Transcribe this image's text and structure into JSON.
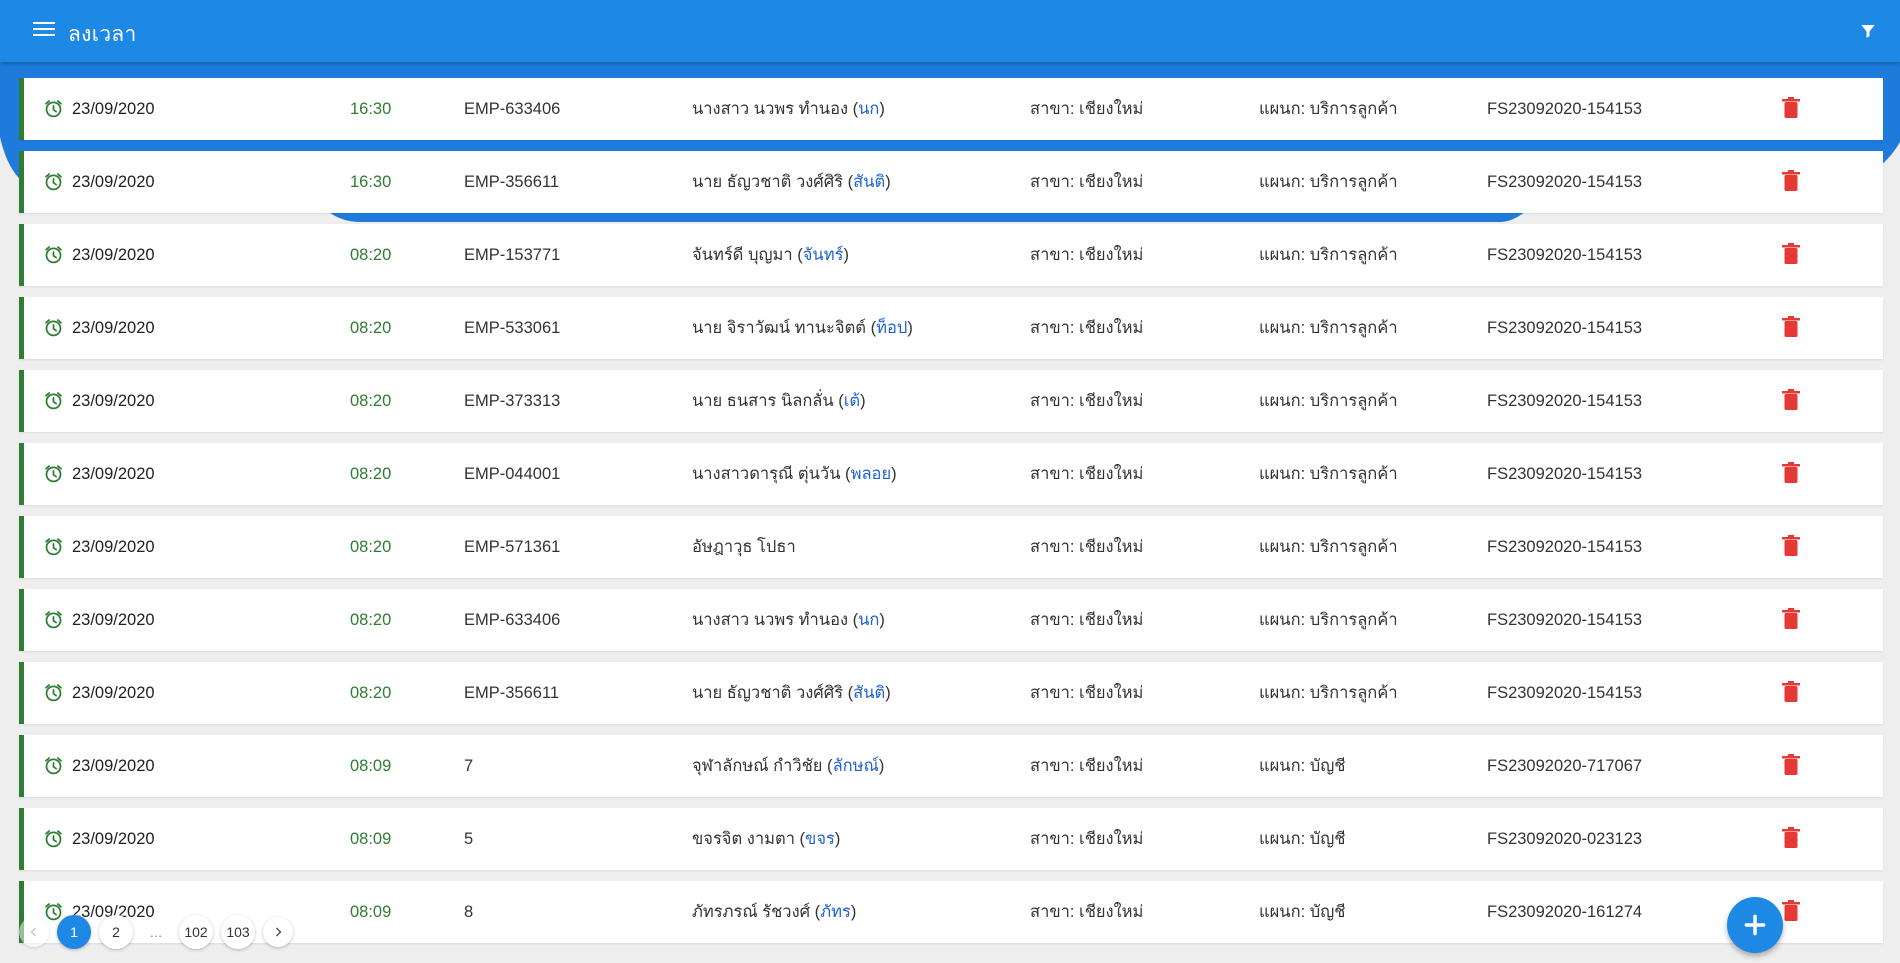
{
  "appbar": {
    "title": "ลงเวลา",
    "menu_icon": "menu-icon",
    "filter_icon": "filter-icon",
    "color": "#1e88e5"
  },
  "rows": [
    {
      "date": "23/09/2020",
      "time": "16:30",
      "emp": "EMP-633406",
      "name": "นางสาว นวพร ทำนอง (",
      "nick": "นก",
      "close": ")",
      "branch": "สาขา: เชียงใหม่",
      "dept": "แผนก: บริการลูกค้า",
      "doc": "FS23092020-154153"
    },
    {
      "date": "23/09/2020",
      "time": "16:30",
      "emp": "EMP-356611",
      "name": "นาย ธัญวชาติ วงศ์ศิริ (",
      "nick": "สันติ",
      "close": ")",
      "branch": "สาขา: เชียงใหม่",
      "dept": "แผนก: บริการลูกค้า",
      "doc": "FS23092020-154153"
    },
    {
      "date": "23/09/2020",
      "time": "08:20",
      "emp": "EMP-153771",
      "name": "จันทร์ดี บุญมา (",
      "nick": "จันทร์",
      "close": ")",
      "branch": "สาขา: เชียงใหม่",
      "dept": "แผนก: บริการลูกค้า",
      "doc": "FS23092020-154153"
    },
    {
      "date": "23/09/2020",
      "time": "08:20",
      "emp": "EMP-533061",
      "name": "นาย จิราวัฒน์ ทานะจิตต์ (",
      "nick": "ท็อป",
      "close": ")",
      "branch": "สาขา: เชียงใหม่",
      "dept": "แผนก: บริการลูกค้า",
      "doc": "FS23092020-154153"
    },
    {
      "date": "23/09/2020",
      "time": "08:20",
      "emp": "EMP-373313",
      "name": "นาย ธนสาร นิลกลั่น (",
      "nick": "เต้",
      "close": ")",
      "branch": "สาขา: เชียงใหม่",
      "dept": "แผนก: บริการลูกค้า",
      "doc": "FS23092020-154153"
    },
    {
      "date": "23/09/2020",
      "time": "08:20",
      "emp": "EMP-044001",
      "name": "นางสาวดารุณี ตุ่นวัน (",
      "nick": "พลอย",
      "close": ")",
      "branch": "สาขา: เชียงใหม่",
      "dept": "แผนก: บริการลูกค้า",
      "doc": "FS23092020-154153"
    },
    {
      "date": "23/09/2020",
      "time": "08:20",
      "emp": "EMP-571361",
      "name": "อัษฎาวุธ โปธา",
      "nick": "",
      "close": "",
      "branch": "สาขา: เชียงใหม่",
      "dept": "แผนก: บริการลูกค้า",
      "doc": "FS23092020-154153"
    },
    {
      "date": "23/09/2020",
      "time": "08:20",
      "emp": "EMP-633406",
      "name": "นางสาว นวพร ทำนอง (",
      "nick": "นก",
      "close": ")",
      "branch": "สาขา: เชียงใหม่",
      "dept": "แผนก: บริการลูกค้า",
      "doc": "FS23092020-154153"
    },
    {
      "date": "23/09/2020",
      "time": "08:20",
      "emp": "EMP-356611",
      "name": "นาย ธัญวชาติ วงศ์ศิริ (",
      "nick": "สันติ",
      "close": ")",
      "branch": "สาขา: เชียงใหม่",
      "dept": "แผนก: บริการลูกค้า",
      "doc": "FS23092020-154153"
    },
    {
      "date": "23/09/2020",
      "time": "08:09",
      "emp": "7",
      "name": "จุฬาลักษณ์ กำวิชัย (",
      "nick": "ลักษณ์",
      "close": ")",
      "branch": "สาขา: เชียงใหม่",
      "dept": "แผนก: บัญชี",
      "doc": "FS23092020-717067"
    },
    {
      "date": "23/09/2020",
      "time": "08:09",
      "emp": "5",
      "name": "ขจรจิต งามตา (",
      "nick": "ขจร",
      "close": ")",
      "branch": "สาขา: เชียงใหม่",
      "dept": "แผนก: บัญชี",
      "doc": "FS23092020-023123"
    },
    {
      "date": "23/09/2020",
      "time": "08:09",
      "emp": "8",
      "name": "ภัทรภรณ์ รัชวงศ์ (",
      "nick": "ภัทร",
      "close": ")",
      "branch": "สาขา: เชียงใหม่",
      "dept": "แผนก: บัญชี",
      "doc": "FS23092020-161274"
    }
  ],
  "pagination": {
    "prev_icon": "chevron-left-icon",
    "next_icon": "chevron-right-icon",
    "pages": [
      "1",
      "2",
      "…",
      "102",
      "103"
    ],
    "current": "1"
  },
  "fab": {
    "icon": "plus-icon"
  },
  "colors": {
    "accent": "#1e88e5",
    "time_green": "#2e7d32",
    "nickname_blue": "#1e63d6",
    "delete_red": "#e53935"
  }
}
